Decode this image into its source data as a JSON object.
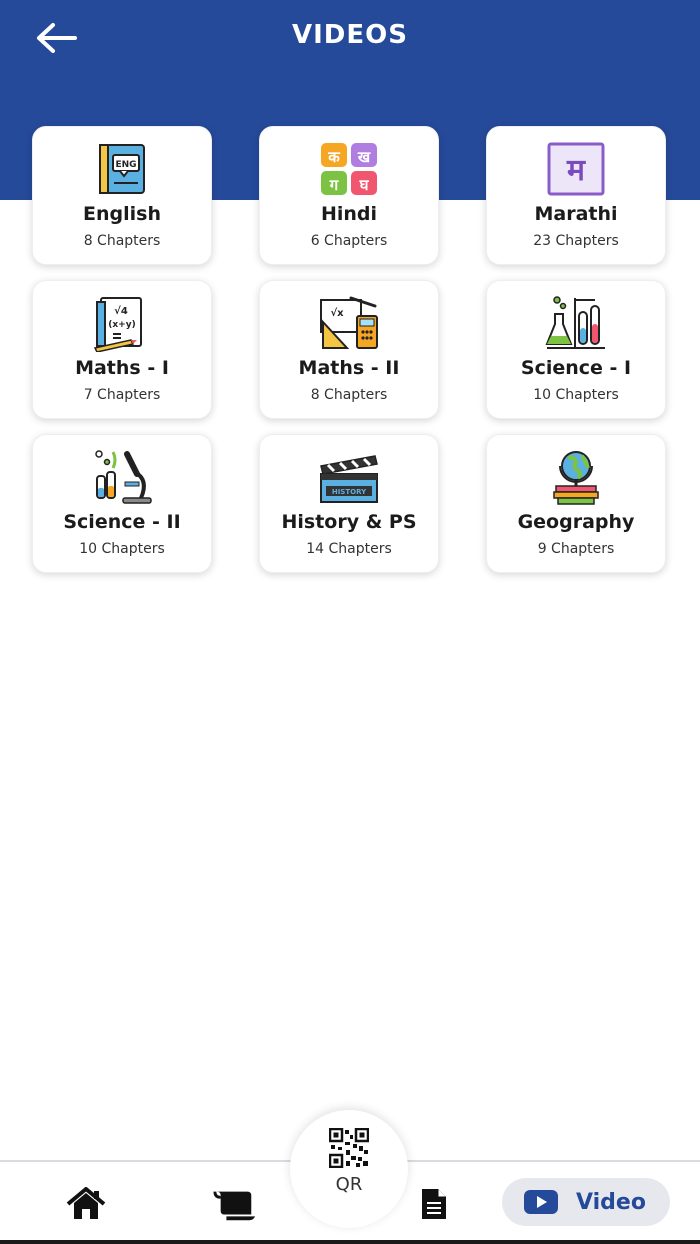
{
  "header": {
    "title": "VIDEOS",
    "back_icon": "arrow-left-icon",
    "background_color": "#264a9a"
  },
  "subjects": [
    {
      "name": "English",
      "chapters": "8 Chapters",
      "icon": "english-book-icon"
    },
    {
      "name": "Hindi",
      "chapters": "6 Chapters",
      "icon": "hindi-letters-icon",
      "letters": [
        "क",
        "ख",
        "ग",
        "घ"
      ]
    },
    {
      "name": "Marathi",
      "chapters": "23 Chapters",
      "icon": "marathi-letter-icon",
      "letter": "म"
    },
    {
      "name": "Maths - I",
      "chapters": "7 Chapters",
      "icon": "maths-notebook-icon"
    },
    {
      "name": "Maths - II",
      "chapters": "8 Chapters",
      "icon": "geometry-tools-icon"
    },
    {
      "name": "Science - I",
      "chapters": "10 Chapters",
      "icon": "lab-flasks-icon"
    },
    {
      "name": "Science - II",
      "chapters": "10 Chapters",
      "icon": "microscope-icon"
    },
    {
      "name": "History & PS",
      "chapters": "14 Chapters",
      "icon": "history-clapper-icon"
    },
    {
      "name": "Geography",
      "chapters": "9 Chapters",
      "icon": "globe-books-icon"
    }
  ],
  "icon_text": {
    "english_badge": "ENG",
    "maths_formula_1": "√4",
    "maths_formula_2": "(x+y)",
    "maths_ii_formula": "√x",
    "history_badge": "HISTORY"
  },
  "bottom_nav": {
    "home_icon": "home-icon",
    "scroll_icon": "scroll-icon",
    "qr_label": "QR",
    "qr_icon": "qr-code-icon",
    "document_icon": "document-icon",
    "video_label": "Video",
    "video_icon": "youtube-play-icon",
    "active_color": "#264a9a"
  }
}
